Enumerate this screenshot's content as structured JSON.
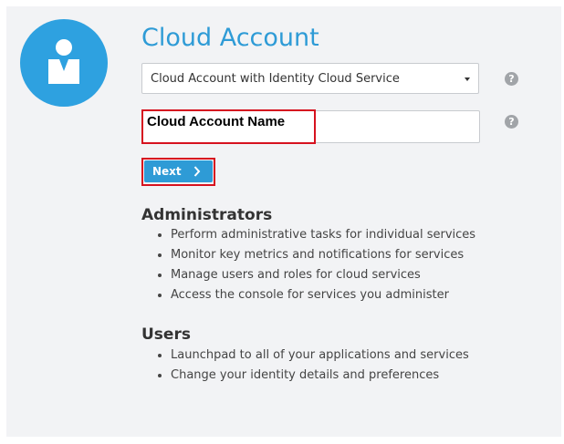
{
  "page": {
    "title": "Cloud Account"
  },
  "account_type_select": {
    "selected": "Cloud Account with Identity Cloud Service",
    "help_icon": "?"
  },
  "account_name_field": {
    "value": "Cloud Account Name",
    "help_icon": "?"
  },
  "next_button": {
    "label": "Next",
    "icon": "chevron-right-icon"
  },
  "administrators": {
    "heading": "Administrators",
    "items": [
      "Perform administrative tasks for individual services",
      "Monitor key metrics and notifications for services",
      "Manage users and roles for cloud services",
      "Access the console for services you administer"
    ]
  },
  "users": {
    "heading": "Users",
    "items": [
      "Launchpad to all of your applications and services",
      "Change your identity details and preferences"
    ]
  },
  "colors": {
    "accent": "#2e9bd6",
    "highlight_border": "#d6121f",
    "panel_background": "#f2f3f5"
  }
}
